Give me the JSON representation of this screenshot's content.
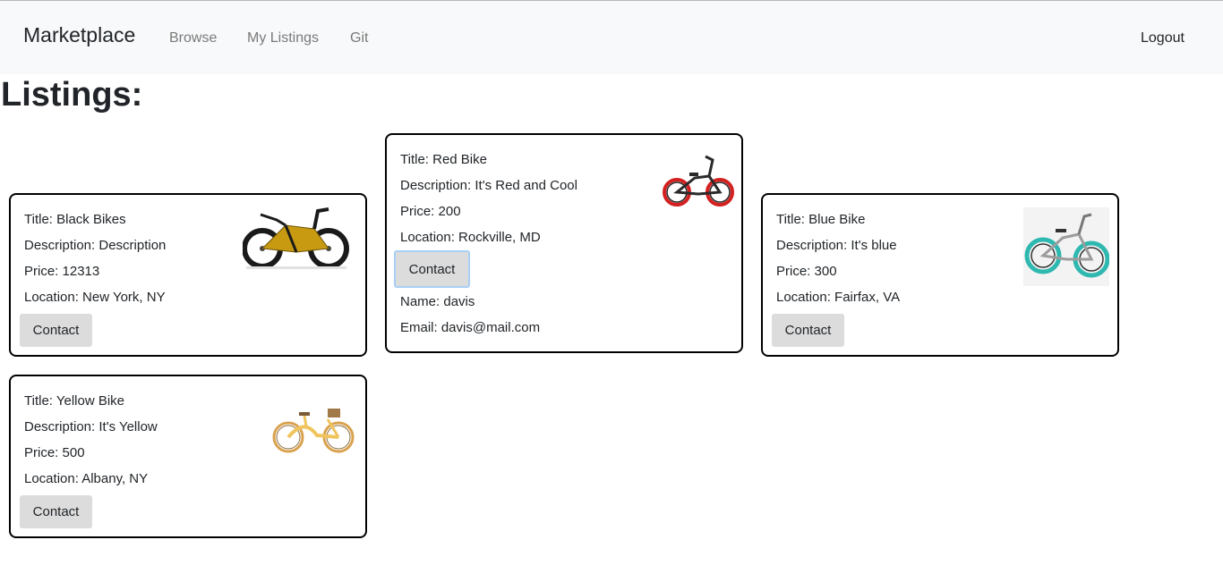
{
  "navbar": {
    "brand": "Marketplace",
    "links": [
      "Browse",
      "My Listings",
      "Git"
    ],
    "logout": "Logout"
  },
  "page": {
    "title": "Listings:"
  },
  "listings": [
    {
      "title": "Title: Black Bikes",
      "description": "Description: Description",
      "price": "Price: 12313",
      "location": "Location: New York, NY",
      "contact_label": "Contact",
      "image_icon": "black-bike-image"
    },
    {
      "title": "Title: Red Bike",
      "description": "Description: It's Red and Cool",
      "price": "Price: 200",
      "location": "Location: Rockville, MD",
      "contact_label": "Contact",
      "seller_name": "Name: davis",
      "seller_email": "Email: davis@mail.com",
      "image_icon": "red-bmx-image"
    },
    {
      "title": "Title: Blue Bike",
      "description": "Description: It's blue",
      "price": "Price: 300",
      "location": "Location: Fairfax, VA",
      "contact_label": "Contact",
      "image_icon": "teal-bmx-image"
    },
    {
      "title": "Title: Yellow Bike",
      "description": "Description: It's Yellow",
      "price": "Price: 500",
      "location": "Location: Albany, NY",
      "contact_label": "Contact",
      "image_icon": "yellow-cruiser-image"
    }
  ],
  "colors": {
    "navbar_bg": "#f8f9fa",
    "card_border": "#000000",
    "button_bg": "#dcdcdc",
    "focus_ring": "#a9cff4"
  }
}
